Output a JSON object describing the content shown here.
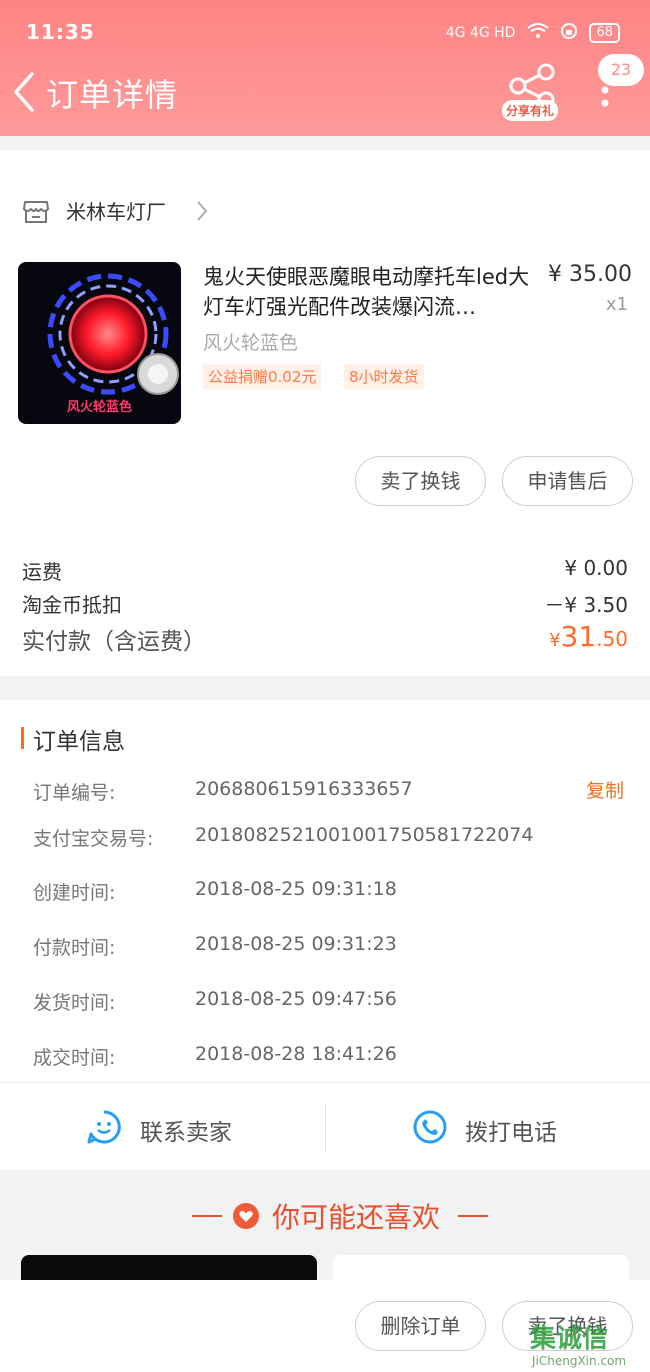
{
  "status_bar": {
    "time": "11:35",
    "network": "4G 4G HD",
    "battery": "68"
  },
  "header": {
    "title": "订单详情",
    "share_label": "分享有礼",
    "badge": "23"
  },
  "shop": {
    "name": "米林车灯厂"
  },
  "product": {
    "title": "鬼火天使眼恶魔眼电动摩托车led大灯车灯强光配件改装爆闪流…",
    "price": "¥ 35.00",
    "quantity": "x1",
    "variant": "风火轮蓝色",
    "image_caption": "风火轮蓝色",
    "tags": [
      "公益捐赠0.02元",
      "8小时发货"
    ]
  },
  "item_actions": {
    "sell_label": "卖了换钱",
    "after_sale_label": "申请售后"
  },
  "totals": {
    "shipping_label": "运费",
    "shipping_value": "¥ 0.00",
    "coin_label": "淘金币抵扣",
    "coin_value": "－¥ 3.50",
    "paid_label": "实付款（含运费）",
    "paid_symbol": "¥",
    "paid_int": "31",
    "paid_dec": ".50"
  },
  "order_info": {
    "title": "订单信息",
    "copy_label": "复制",
    "rows": [
      {
        "label": "订单编号:",
        "value": "206880615916333657"
      },
      {
        "label": "支付宝交易号:",
        "value": "2018082521001001750581722074"
      },
      {
        "label": "创建时间:",
        "value": "2018-08-25 09:31:18"
      },
      {
        "label": "付款时间:",
        "value": "2018-08-25 09:31:23"
      },
      {
        "label": "发货时间:",
        "value": "2018-08-25 09:47:56"
      },
      {
        "label": "成交时间:",
        "value": "2018-08-28 18:41:26"
      }
    ]
  },
  "contact": {
    "seller_label": "联系卖家",
    "phone_label": "拨打电话"
  },
  "recommend": {
    "title": "你可能还喜欢"
  },
  "bottom_bar": {
    "delete_label": "删除订单",
    "sell_label": "卖了换钱"
  },
  "watermark": {
    "main": "集诚信",
    "sub": "JiChengXin.com"
  },
  "colors": {
    "header": "#ff8484",
    "accent": "#ff6b2b",
    "price_orange": "#e8722a"
  }
}
